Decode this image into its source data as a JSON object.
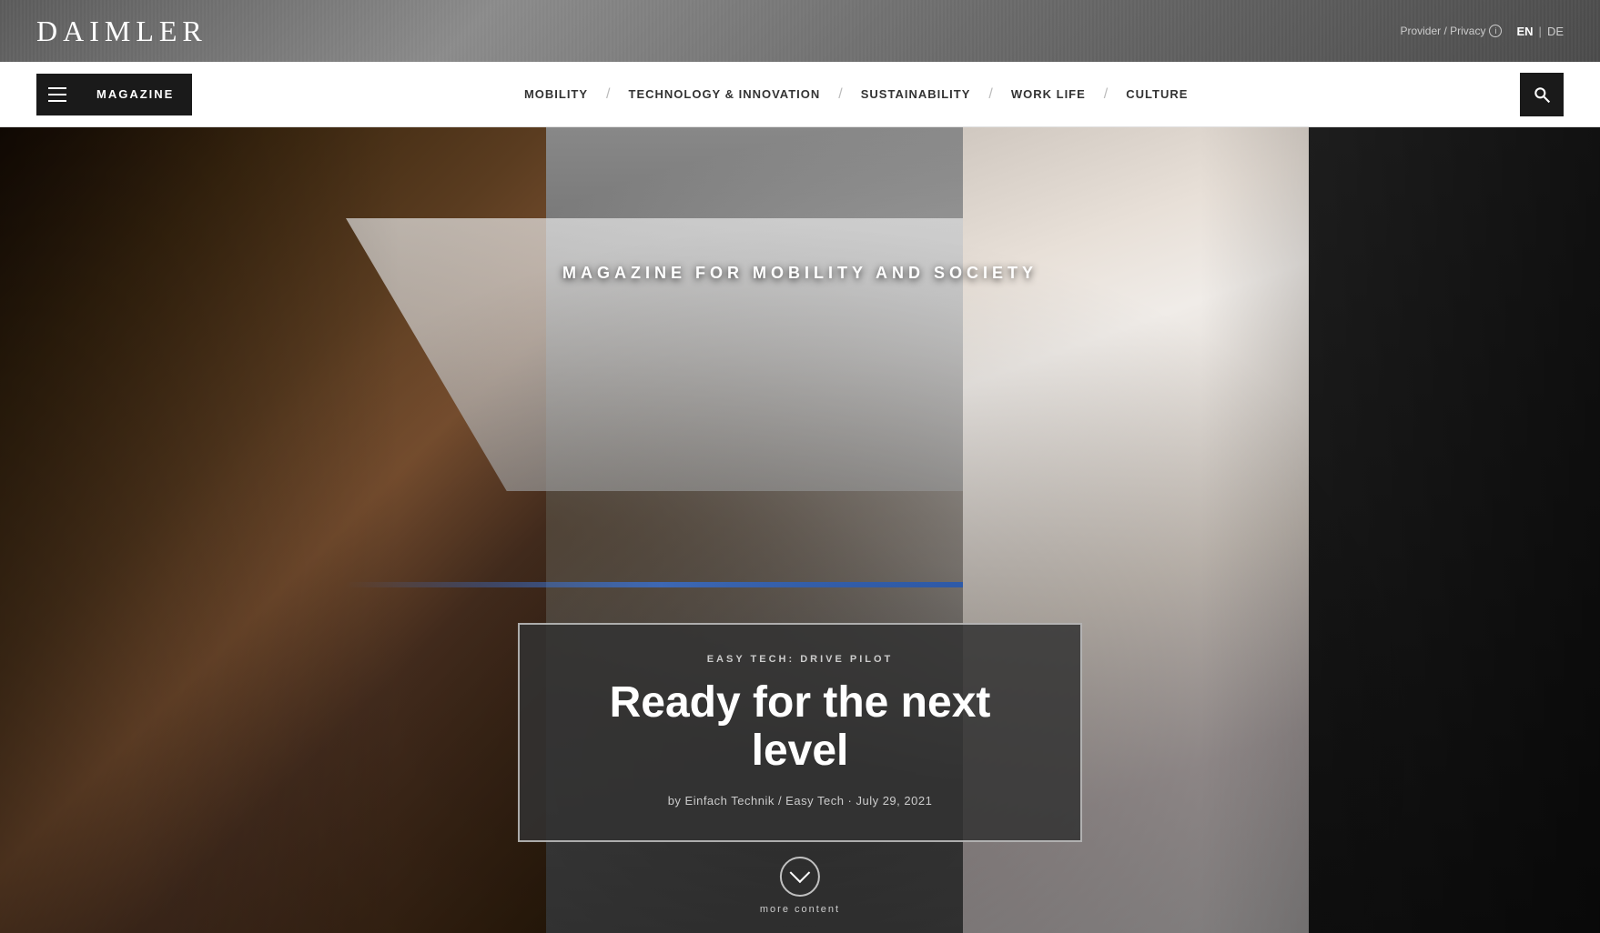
{
  "topbar": {
    "logo": "DAIMLER",
    "provider_label": "Provider / Privacy",
    "lang_en": "EN",
    "lang_sep": "|",
    "lang_de": "DE"
  },
  "navbar": {
    "hamburger_label": "menu",
    "magazine_label": "MAGAZINE",
    "nav_items": [
      {
        "id": "mobility",
        "label": "MOBILITY"
      },
      {
        "id": "tech",
        "label": "TECHNOLOGY & INNOVATION"
      },
      {
        "id": "sustainability",
        "label": "SUSTAINABILITY"
      },
      {
        "id": "work",
        "label": "WORK LIFE"
      },
      {
        "id": "culture",
        "label": "CULTURE"
      }
    ],
    "search_label": "search"
  },
  "hero": {
    "subtitle": "MAGAZINE FOR MOBILITY AND SOCIETY",
    "card": {
      "category": "EASY TECH: DRIVE PILOT",
      "title": "Ready for the next level",
      "meta": "by Einfach Technik / Easy Tech · July 29, 2021"
    },
    "scroll_label": "more content"
  }
}
